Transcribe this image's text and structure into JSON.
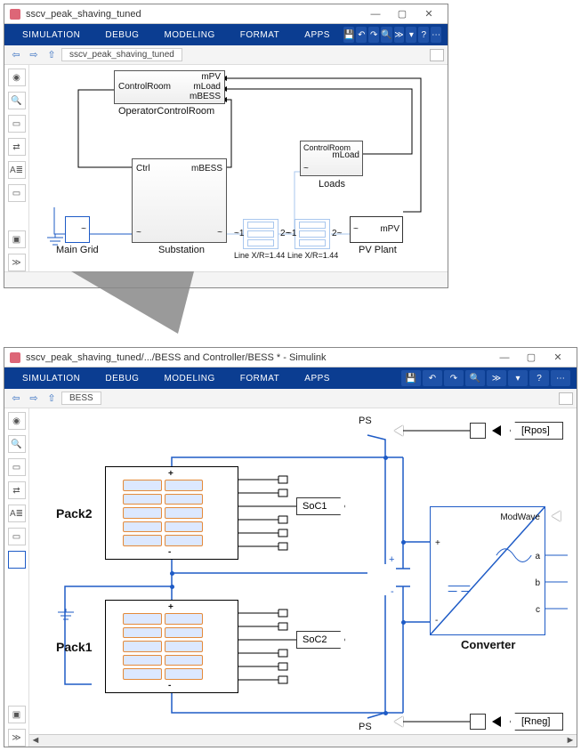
{
  "top_window": {
    "title": "sscv_peak_shaving_tuned",
    "tabs": [
      "SIMULATION",
      "DEBUG",
      "MODELING",
      "FORMAT",
      "APPS"
    ],
    "breadcrumb": "sscv_peak_shaving_tuned",
    "blocks": {
      "ocr": {
        "name": "OperatorControlRoom",
        "ports": {
          "left": "ControlRoom",
          "r1": "mPV",
          "r2": "mLoad",
          "r3": "mBESS"
        }
      },
      "loads": {
        "name": "Loads",
        "ports": {
          "tl": "ControlRoom",
          "tr": "mLoad",
          "bl": "~"
        }
      },
      "substation": {
        "name": "Substation",
        "ports": {
          "tl": "Ctrl",
          "tr": "mBESS",
          "bl": "~",
          "br": "~"
        }
      },
      "maingrid": {
        "name": "Main Grid",
        "port": "~"
      },
      "line1_lbl": "Line X/R=1.44",
      "line2_lbl": "Line X/R=1.44",
      "line_port_l": "~1",
      "line_port_r": "2~",
      "pv": {
        "name": "PV Plant",
        "ports": {
          "l": "~",
          "r": "mPV"
        }
      }
    }
  },
  "bottom_window": {
    "title": "sscv_peak_shaving_tuned/.../BESS and Controller/BESS * - Simulink",
    "tabs": [
      "SIMULATION",
      "DEBUG",
      "MODELING",
      "FORMAT",
      "APPS"
    ],
    "breadcrumb": "BESS",
    "labels": {
      "pack1": "Pack1",
      "pack2": "Pack2",
      "converter": "Converter",
      "ps_top": "PS",
      "ps_bot": "PS",
      "soc1": "SoC1",
      "soc2": "SoC2",
      "rpos": "[Rpos]",
      "rneg": "[Rneg]",
      "modwave": "ModWave",
      "a": "a",
      "b": "b",
      "c": "c",
      "plus": "+",
      "minus": "-",
      "pack_plus": "+",
      "pack_minus": "-"
    }
  }
}
